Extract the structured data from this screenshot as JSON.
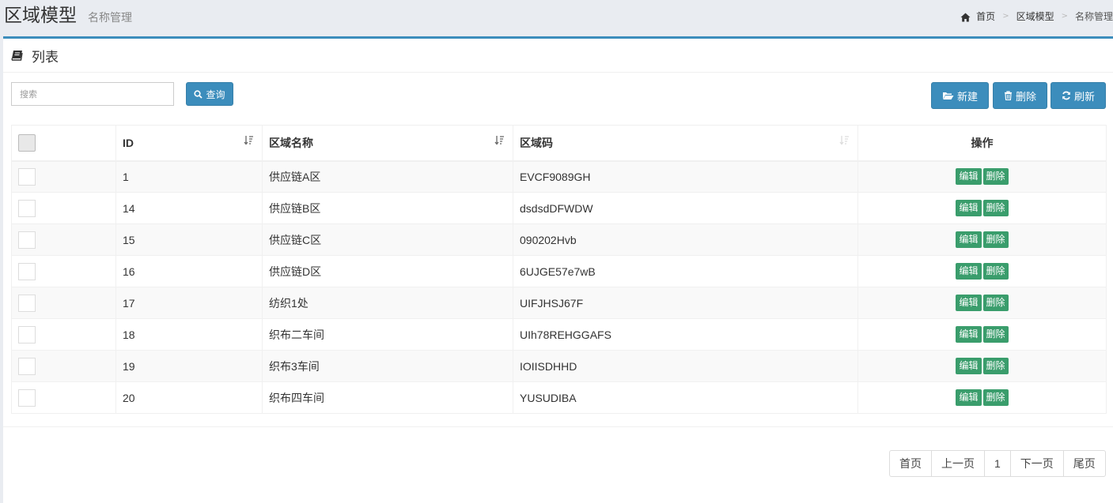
{
  "header": {
    "title": "区域模型",
    "subtitle": "名称管理",
    "breadcrumb": [
      "首页",
      "区域模型",
      "名称管理"
    ]
  },
  "panel": {
    "title": "列表"
  },
  "search": {
    "placeholder": "搜索",
    "button_label": "查询"
  },
  "toolbar": {
    "new_label": "新建",
    "delete_label": "删除",
    "refresh_label": "刷新"
  },
  "table": {
    "columns": [
      "ID",
      "区域名称",
      "区域码",
      "操作"
    ],
    "rows": [
      {
        "id": "1",
        "name": "供应链A区",
        "code": "EVCF9089GH"
      },
      {
        "id": "14",
        "name": "供应链B区",
        "code": "dsdsdDFWDW"
      },
      {
        "id": "15",
        "name": "供应链C区",
        "code": "090202Hvb"
      },
      {
        "id": "16",
        "name": "供应链D区",
        "code": "6UJGE57e7wB"
      },
      {
        "id": "17",
        "name": "纺织1处",
        "code": "UIFJHSJ67F"
      },
      {
        "id": "18",
        "name": "织布二车间",
        "code": "UIh78REHGGAFS"
      },
      {
        "id": "19",
        "name": "织布3车间",
        "code": "IOIISDHHD"
      },
      {
        "id": "20",
        "name": "织布四车间",
        "code": "YUSUDIBA"
      }
    ],
    "row_actions": {
      "edit": "编辑",
      "delete": "删除"
    }
  },
  "pagination": {
    "first": "首页",
    "prev": "上一页",
    "current": "1",
    "next": "下一页",
    "last": "尾页"
  },
  "colors": {
    "primary": "#3c8dbc",
    "action_green": "#3a9d6c",
    "header_bg": "#e9ecf1"
  },
  "icons": [
    "home-icon",
    "book-icon",
    "search-icon",
    "folder-open-icon",
    "trash-icon",
    "refresh-icon",
    "sort-icon"
  ]
}
